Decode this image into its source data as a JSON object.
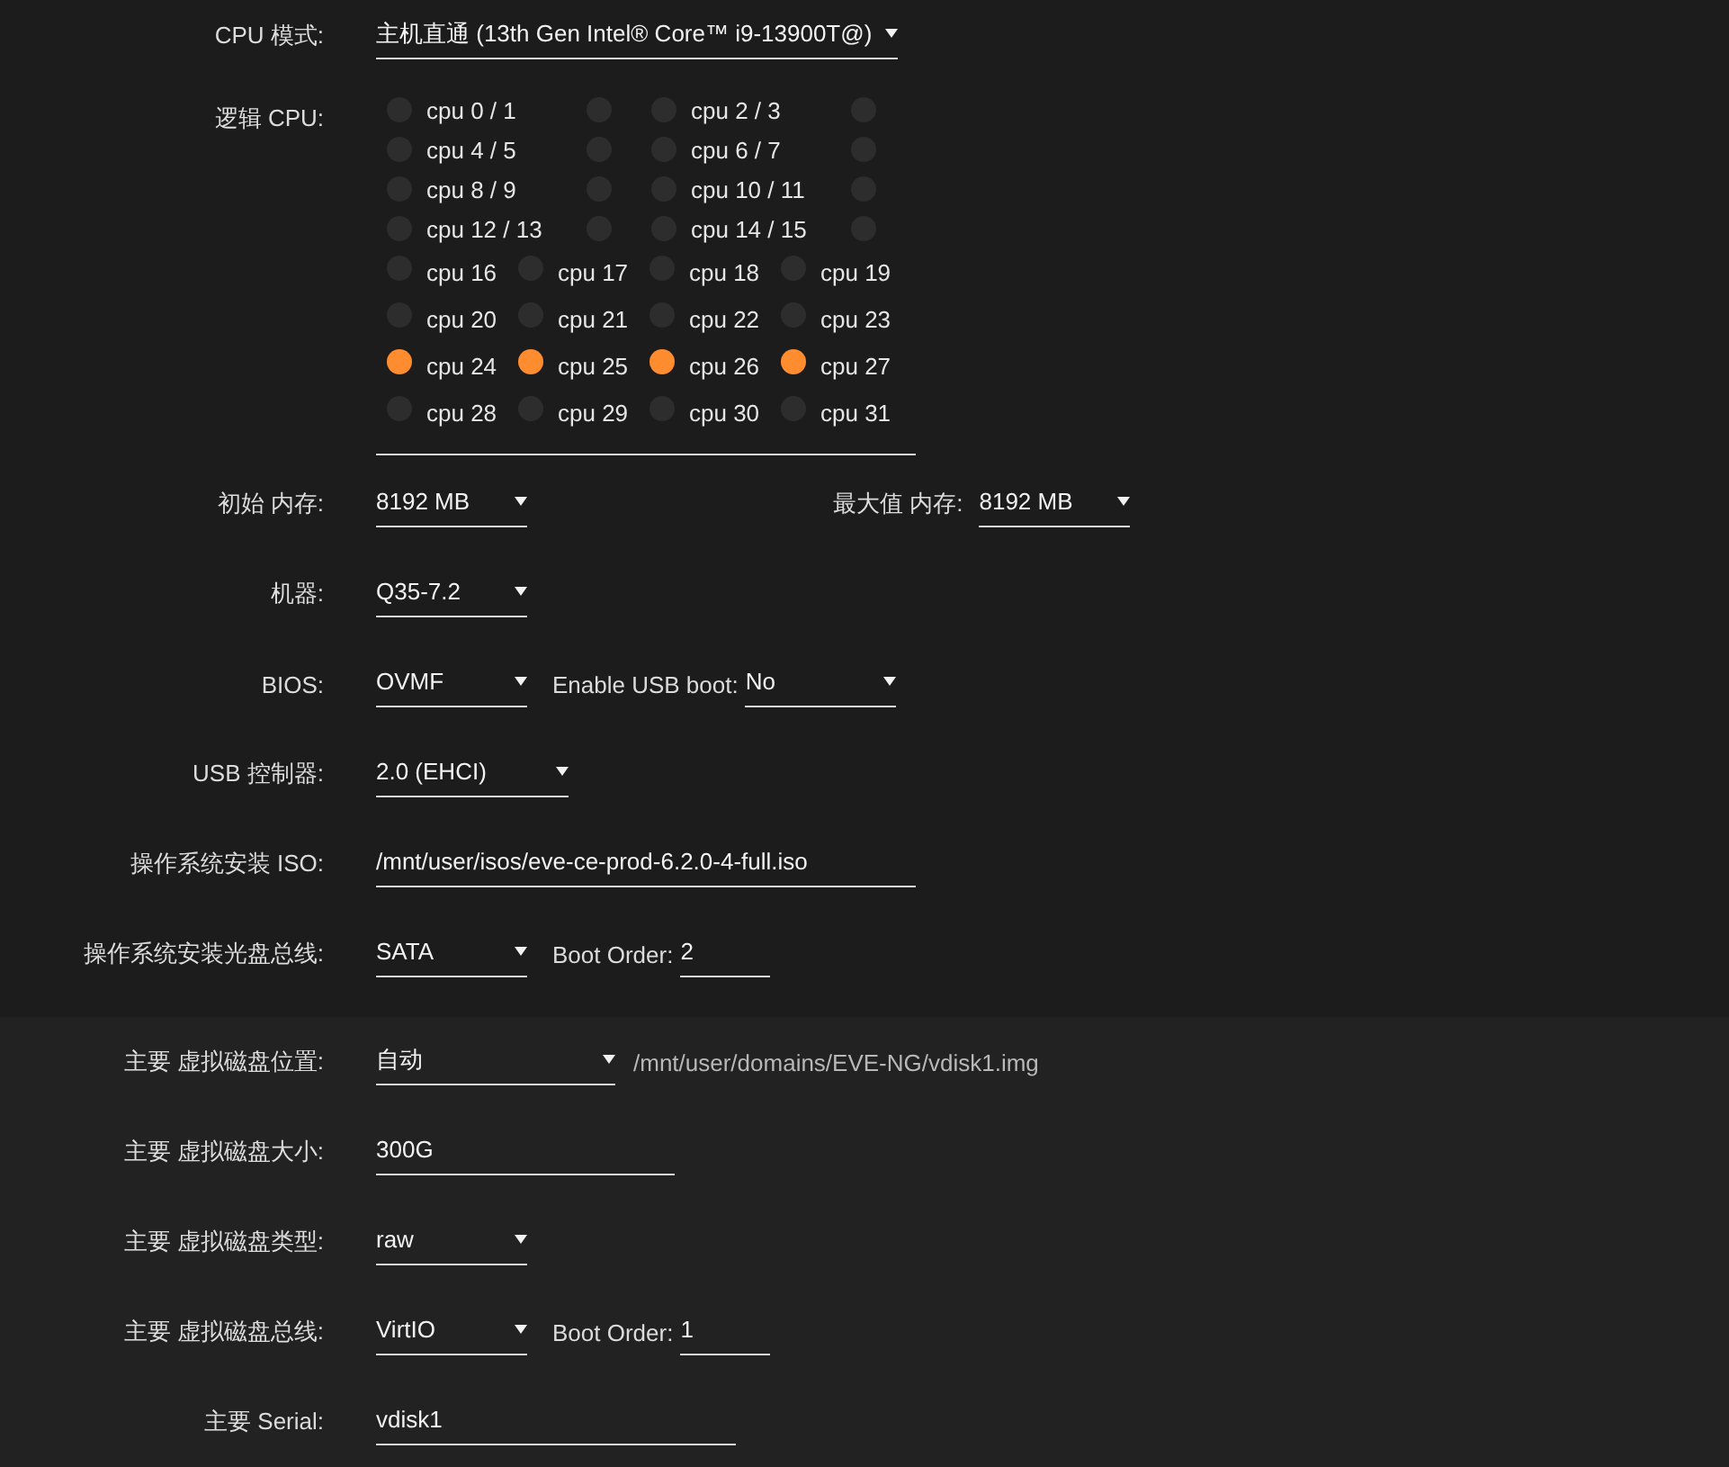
{
  "cpu_mode": {
    "label": "CPU 模式:",
    "value": "主机直通 (13th Gen Intel® Core™ i9-13900T@)"
  },
  "logical_cpu": {
    "label": "逻辑 CPU:",
    "rows": [
      {
        "kind": "pair",
        "items": [
          {
            "label": "cpu 0 / 1",
            "selected": false,
            "twin_selected": false
          },
          {
            "label": "cpu 2 / 3",
            "selected": false,
            "twin_selected": false
          }
        ]
      },
      {
        "kind": "pair",
        "items": [
          {
            "label": "cpu 4 / 5",
            "selected": false,
            "twin_selected": false
          },
          {
            "label": "cpu 6 / 7",
            "selected": false,
            "twin_selected": false
          }
        ]
      },
      {
        "kind": "pair",
        "items": [
          {
            "label": "cpu 8 / 9",
            "selected": false,
            "twin_selected": false
          },
          {
            "label": "cpu 10 / 11",
            "selected": false,
            "twin_selected": false
          }
        ]
      },
      {
        "kind": "pair",
        "items": [
          {
            "label": "cpu 12 / 13",
            "selected": false,
            "twin_selected": false
          },
          {
            "label": "cpu 14 / 15",
            "selected": false,
            "twin_selected": false
          }
        ]
      },
      {
        "kind": "single",
        "items": [
          {
            "label": "cpu 16",
            "selected": false
          },
          {
            "label": "cpu 17",
            "selected": false
          },
          {
            "label": "cpu 18",
            "selected": false
          },
          {
            "label": "cpu 19",
            "selected": false
          }
        ]
      },
      {
        "kind": "single",
        "items": [
          {
            "label": "cpu 20",
            "selected": false
          },
          {
            "label": "cpu 21",
            "selected": false
          },
          {
            "label": "cpu 22",
            "selected": false
          },
          {
            "label": "cpu 23",
            "selected": false
          }
        ]
      },
      {
        "kind": "single",
        "items": [
          {
            "label": "cpu 24",
            "selected": true
          },
          {
            "label": "cpu 25",
            "selected": true
          },
          {
            "label": "cpu 26",
            "selected": true
          },
          {
            "label": "cpu 27",
            "selected": true
          }
        ]
      },
      {
        "kind": "single",
        "items": [
          {
            "label": "cpu 28",
            "selected": false
          },
          {
            "label": "cpu 29",
            "selected": false
          },
          {
            "label": "cpu 30",
            "selected": false
          },
          {
            "label": "cpu 31",
            "selected": false
          }
        ]
      }
    ]
  },
  "sections": [
    {
      "rows": [
        {
          "label": "初始 内存:",
          "controls": [
            {
              "kind": "select",
              "value": "8192 MB"
            }
          ],
          "aside": {
            "label": "最大值 内存:",
            "value": "8192 MB"
          }
        },
        {
          "label": "机器:",
          "controls": [
            {
              "kind": "select",
              "value": "Q35-7.2"
            }
          ]
        },
        {
          "label": "BIOS:",
          "controls": [
            {
              "kind": "select",
              "value": "OVMF"
            },
            {
              "kind": "label",
              "text": "Enable USB boot:"
            },
            {
              "kind": "select",
              "value": "No"
            }
          ]
        },
        {
          "label": "USB 控制器:",
          "controls": [
            {
              "kind": "select",
              "value": "2.0 (EHCI)"
            }
          ]
        },
        {
          "label": "操作系统安装 ISO:",
          "controls": [
            {
              "kind": "text",
              "value": "/mnt/user/isos/eve-ce-prod-6.2.0-4-full.iso"
            }
          ]
        },
        {
          "label": "操作系统安装光盘总线:",
          "controls": [
            {
              "kind": "select",
              "value": "SATA"
            },
            {
              "kind": "label",
              "text": "Boot Order:"
            },
            {
              "kind": "text",
              "value": "2"
            }
          ]
        }
      ]
    },
    {
      "rows": [
        {
          "label": "主要 虚拟磁盘位置:",
          "controls": [
            {
              "kind": "select",
              "value": "自动"
            },
            {
              "kind": "note",
              "text": "/mnt/user/domains/EVE-NG/vdisk1.img"
            }
          ]
        },
        {
          "label": "主要 虚拟磁盘大小:",
          "controls": [
            {
              "kind": "text",
              "value": "300G"
            }
          ]
        },
        {
          "label": "主要 虚拟磁盘类型:",
          "controls": [
            {
              "kind": "select",
              "value": "raw"
            }
          ]
        },
        {
          "label": "主要 虚拟磁盘总线:",
          "controls": [
            {
              "kind": "select",
              "value": "VirtIO"
            },
            {
              "kind": "label",
              "text": "Boot Order:"
            },
            {
              "kind": "text",
              "value": "1"
            }
          ]
        },
        {
          "label": "主要 Serial:",
          "controls": [
            {
              "kind": "text",
              "value": "vdisk1"
            }
          ]
        }
      ]
    }
  ]
}
